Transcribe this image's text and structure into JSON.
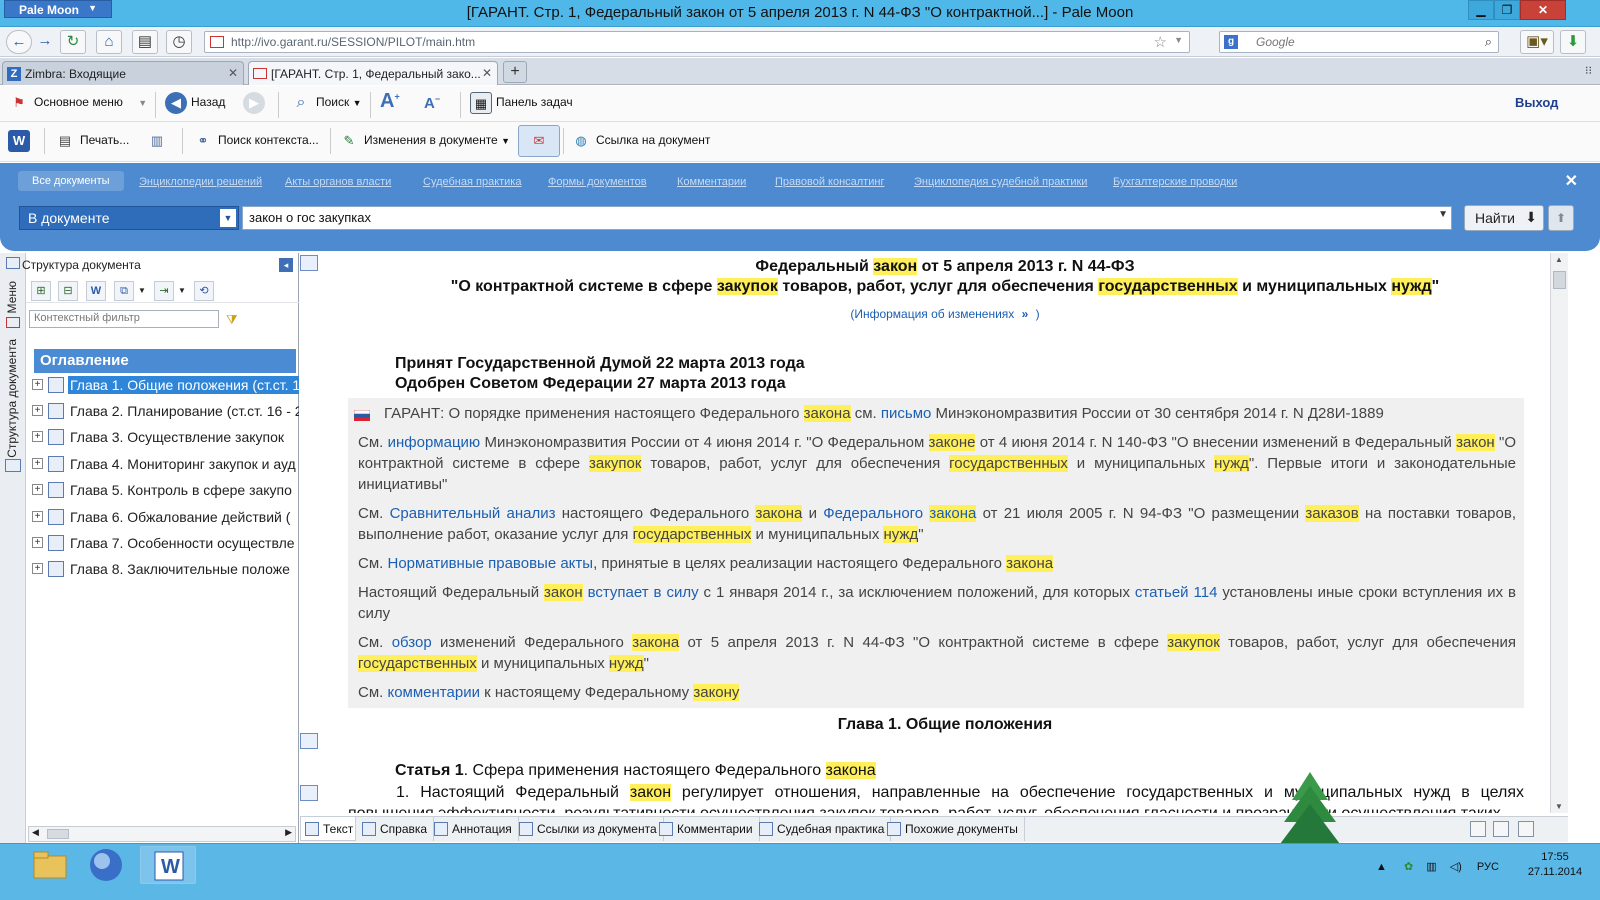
{
  "window": {
    "app_button": "Pale Moon",
    "title": "[ГАРАНТ. Стр. 1, Федеральный закон от 5 апреля 2013 г. N 44-ФЗ \"О контрактной...] - Pale Moon"
  },
  "nav": {
    "url": "http://ivo.garant.ru/SESSION/PILOT/main.htm",
    "search_placeholder": "Google"
  },
  "tabs": [
    {
      "label": "Zimbra: Входящие",
      "icon": "Z"
    },
    {
      "label": "[ГАРАНТ. Стр. 1, Федеральный зако...",
      "icon": "flag"
    }
  ],
  "toolbar1": {
    "main_menu": "Основное меню",
    "back": "Назад",
    "search": "Поиск",
    "taskbar_panel": "Панель задач",
    "exit": "Выход"
  },
  "toolbar2": {
    "print": "Печать...",
    "context_search": "Поиск контекста...",
    "changes": "Изменения в документе",
    "doc_link": "Ссылка на документ"
  },
  "search_band": {
    "tabs": [
      "Все документы",
      "Энциклопедии решений",
      "Акты органов власти",
      "Судебная практика",
      "Формы документов",
      "Комментарии",
      "Правовой консалтинг",
      "Энциклопедия судебной практики",
      "Бухгалтерские проводки"
    ],
    "scope": "В документе",
    "query": "закон о гос закупках",
    "find_button": "Найти"
  },
  "left_panel": {
    "title": "Структура документа",
    "side_labels": [
      "Меню",
      "Структура документа"
    ],
    "filter_placeholder": "Контекстный фильтр",
    "toc_title": "Оглавление",
    "items": [
      "Глава 1. Общие положения (ст.ст. 1-",
      "Глава 2. Планирование (ст.ст. 16 - 2",
      "Глава 3. Осуществление закупок",
      "Глава 4. Мониторинг закупок и ауд",
      "Глава 5. Контроль в сфере закупо",
      "Глава 6. Обжалование действий (",
      "Глава 7. Особенности осуществле",
      "Глава 8. Заключительные положе"
    ]
  },
  "document": {
    "title_line1": [
      "Федеральный ",
      "закон",
      " от 5 апреля 2013 г. N 44-ФЗ"
    ],
    "title_line2": [
      "\"О контрактной системе в сфере ",
      "закупок",
      " товаров, работ, услуг для обеспечения ",
      "государственных",
      " и муниципальных ",
      "нужд",
      "\""
    ],
    "info_link": "(Информация об изменениях",
    "info_close": ")",
    "adopted": "Принят Государственной Думой 22 марта 2013 года",
    "approved": "Одобрен Советом Федерации 27 марта 2013 года",
    "comments": {
      "garant": [
        "ГАРАНТ: О порядке применения настоящего Федерального ",
        "закона",
        " см. ",
        "письмо",
        " Минэкономразвития России от 30 сентября 2014 г. N Д28И-1889"
      ],
      "c1": [
        "См. ",
        "информацию",
        " Минэкономразвития России от 4 июня 2014 г. \"О Федеральном ",
        "законе",
        " от 4 июня 2014 г. N 140-ФЗ \"О внесении изменений в Федеральный ",
        "закон",
        " \"О контрактной системе в сфере ",
        "закупок",
        " товаров, работ, услуг для обеспечения ",
        "государственных",
        " и муниципальных ",
        "нужд",
        "\". Первые итоги и законодательные инициативы\""
      ],
      "c2": [
        "См. ",
        "Сравнительный анализ",
        " настоящего Федерального ",
        "закона",
        " и ",
        "Федерального",
        " ",
        "закона",
        " от 21 июля 2005 г. N 94-ФЗ \"О размещении ",
        "заказов",
        " на поставки товаров, выполнение работ, оказание услуг для ",
        "государственных",
        " и муниципальных ",
        "нужд",
        "\""
      ],
      "c3": [
        "См. ",
        "Нормативные правовые акты",
        ", принятые в целях реализации настоящего Федерального ",
        "закона"
      ],
      "c4": [
        "Настоящий Федеральный ",
        "закон",
        " ",
        "вступает в силу",
        " с 1 января 2014 г., за исключением положений, для которых ",
        "статьей 114",
        " установлены иные сроки вступления их в силу"
      ],
      "c5": [
        "См. ",
        "обзор",
        " изменений Федерального ",
        "закона",
        " от 5 апреля 2013 г. N 44-ФЗ \"О контрактной системе в сфере ",
        "закупок",
        " товаров, работ, услуг для обеспечения ",
        "государственных",
        " и муниципальных ",
        "нужд",
        "\""
      ],
      "c6": [
        "См. ",
        "комментарии",
        " к настоящему Федеральному ",
        "закону"
      ]
    },
    "chapter": "Глава 1. Общие положения",
    "article": [
      "Статья 1",
      ". Сфера применения настоящего Федерального ",
      "закона"
    ],
    "para1": [
      "1. Настоящий Федеральный ",
      "закон",
      " регулирует отношения, направленные на обеспечение государственных и муниципальных нужд в целях повышения эффективности, результативности осуществления закупок товаров, работ, услуг, обеспечения гласности и прозрачности осуществления таких"
    ]
  },
  "bottom_tabs": [
    "Текст",
    "Справка",
    "Аннотация",
    "Ссылки из документа",
    "Комментарии",
    "Судебная практика",
    "Похожие документы"
  ],
  "taskbar": {
    "lang": "РУС",
    "time": "17:55",
    "date": "27.11.2014"
  },
  "colors": {
    "highlight": "#ffef5a",
    "link": "#1b5fb3",
    "band": "#4d8ad0",
    "toc_header": "#4a8bd4",
    "titlebar": "#4fb8e8"
  }
}
